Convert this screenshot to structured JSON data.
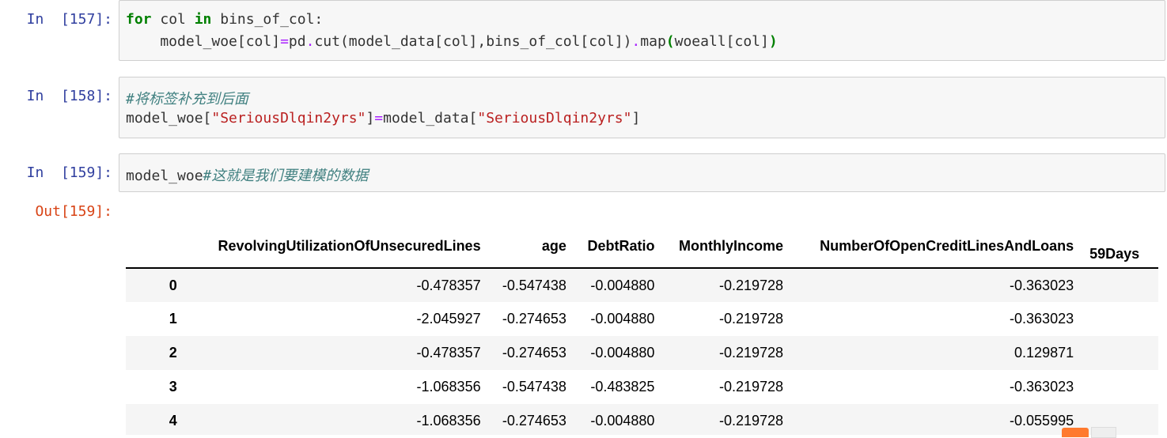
{
  "cells": [
    {
      "prompt": "In  [157]:",
      "lines": [
        [
          {
            "t": "for",
            "c": "kw"
          },
          {
            "t": " col ",
            "c": ""
          },
          {
            "t": "in",
            "c": "kw"
          },
          {
            "t": " bins_of_col:",
            "c": ""
          }
        ],
        [
          {
            "t": "    model_woe[col]",
            "c": ""
          },
          {
            "t": "=",
            "c": "op"
          },
          {
            "t": "pd",
            "c": ""
          },
          {
            "t": ".",
            "c": "op"
          },
          {
            "t": "cut(model_data[col],bins_of_col[col])",
            "c": ""
          },
          {
            "t": ".",
            "c": "op"
          },
          {
            "t": "map",
            "c": ""
          },
          {
            "t": "(",
            "c": "kw"
          },
          {
            "t": "woeall[col]",
            "c": ""
          },
          {
            "t": ")",
            "c": "kw"
          }
        ]
      ]
    },
    {
      "prompt": "In  [158]:",
      "lines": [
        [
          {
            "t": "#将标签补充到后面",
            "c": "cm"
          }
        ],
        [
          {
            "t": "model_woe[",
            "c": ""
          },
          {
            "t": "\"SeriousDlqin2yrs\"",
            "c": "str"
          },
          {
            "t": "]",
            "c": ""
          },
          {
            "t": "=",
            "c": "op"
          },
          {
            "t": "model_data[",
            "c": ""
          },
          {
            "t": "\"SeriousDlqin2yrs\"",
            "c": "str"
          },
          {
            "t": "]",
            "c": ""
          }
        ]
      ]
    },
    {
      "prompt": "In  [159]:",
      "lines": [
        [
          {
            "t": "model_woe",
            "c": ""
          },
          {
            "t": "#这就是我们要建模的数据",
            "c": "cm"
          }
        ]
      ]
    }
  ],
  "output": {
    "prompt": "Out[159]:",
    "columns": [
      "RevolvingUtilizationOfUnsecuredLines",
      "age",
      "DebtRatio",
      "MonthlyIncome",
      "NumberOfOpenCreditLinesAndLoans",
      "59Days"
    ],
    "rows": [
      {
        "index": "0",
        "values": [
          "-0.478357",
          "-0.547438",
          "-0.004880",
          "-0.219728",
          "-0.363023",
          ""
        ]
      },
      {
        "index": "1",
        "values": [
          "-2.045927",
          "-0.274653",
          "-0.004880",
          "-0.219728",
          "-0.363023",
          ""
        ]
      },
      {
        "index": "2",
        "values": [
          "-0.478357",
          "-0.274653",
          "-0.004880",
          "-0.219728",
          "0.129871",
          ""
        ]
      },
      {
        "index": "3",
        "values": [
          "-1.068356",
          "-0.547438",
          "-0.483825",
          "-0.219728",
          "-0.363023",
          ""
        ]
      },
      {
        "index": "4",
        "values": [
          "-1.068356",
          "-0.274653",
          "-0.004880",
          "-0.219728",
          "-0.055995",
          ""
        ]
      }
    ]
  },
  "colors": {
    "in_prompt": "#303f9f",
    "out_prompt": "#d84315",
    "keyword": "#008000",
    "operator": "#aa22ff",
    "string": "#ba2121",
    "comment": "#408080"
  }
}
